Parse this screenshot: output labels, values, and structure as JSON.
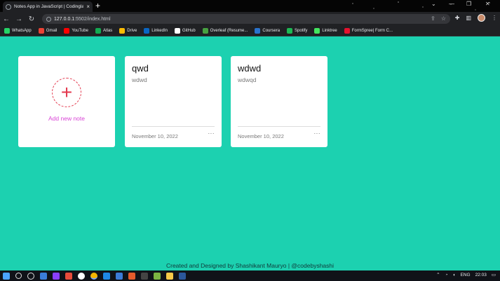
{
  "browser": {
    "tab_title": "Notes App in JavaScript | Codinglab",
    "tab_close": "×",
    "new_tab": "+",
    "url_host": "127.0.0.1",
    "url_rest": ":5502/index.html",
    "window_controls": [
      "⌄",
      "—",
      "❐",
      "✕"
    ]
  },
  "bookmarks": [
    {
      "label": "WhatsApp",
      "color": "#25d366"
    },
    {
      "label": "Gmail",
      "color": "#ea4335"
    },
    {
      "label": "YouTube",
      "color": "#ff0000"
    },
    {
      "label": "Atlas",
      "color": "#13aa52"
    },
    {
      "label": "Drive",
      "color": "#fbbc04"
    },
    {
      "label": "LinkedIn",
      "color": "#0a66c2"
    },
    {
      "label": "GitHub",
      "color": "#ffffff"
    },
    {
      "label": "Overleaf (Resume...",
      "color": "#47a141"
    },
    {
      "label": "Coursera",
      "color": "#2a73cc"
    },
    {
      "label": "Spotify",
      "color": "#1db954"
    },
    {
      "label": "Linktree",
      "color": "#43e55e"
    },
    {
      "label": "FormSpree| Form C...",
      "color": "#e5122e"
    }
  ],
  "add_card": {
    "plus": "+",
    "label": "Add new note"
  },
  "notes": [
    {
      "title": "qwd",
      "body": "wdwd",
      "date": "November 10, 2022",
      "menu": "···"
    },
    {
      "title": "wdwd",
      "body": "wdwqd",
      "date": "November 10, 2022",
      "menu": "···"
    }
  ],
  "footer": "Created and Designed by Shashikant Mauryo | @codebyshashi",
  "taskbar": {
    "lang": "ENG",
    "time": "22:03"
  }
}
